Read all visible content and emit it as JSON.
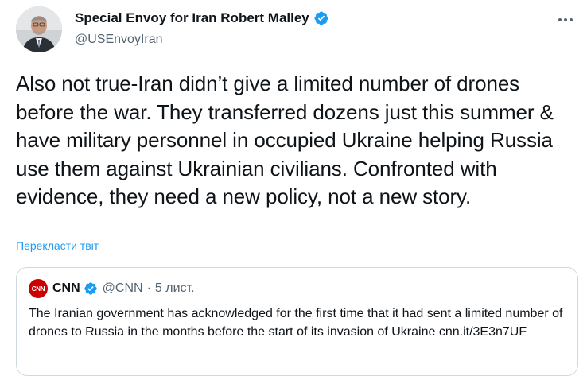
{
  "author": {
    "display_name": "Special Envoy for Iran Robert Malley",
    "handle": "@USEnvoyIran",
    "verified_icon": "verified-badge-icon",
    "avatar_icon": "profile-photo"
  },
  "tweet": {
    "text": "Also not true-Iran didn’t give a limited number of drones before the war. They transferred dozens just this summer & have military personnel in occupied Ukraine helping Russia use them against Ukrainian civilians. Confronted with evidence, they need a new policy, not a new story.",
    "translate_label": "Перекласти твіт",
    "more_icon": "more-options-icon"
  },
  "quote": {
    "avatar_label": "CNN",
    "name": "CNN",
    "handle": "@CNN",
    "separator": "·",
    "time": "5 лист.",
    "text": "The Iranian government has acknowledged for the first time that it had sent a limited number of drones to Russia in the months before the start of its invasion of Ukraine cnn.it/3E3n7UF"
  },
  "colors": {
    "accent": "#1d9bf0",
    "text": "#0f1419",
    "secondary": "#536471",
    "border": "#cfd9de",
    "cnn_red": "#cc0000"
  }
}
